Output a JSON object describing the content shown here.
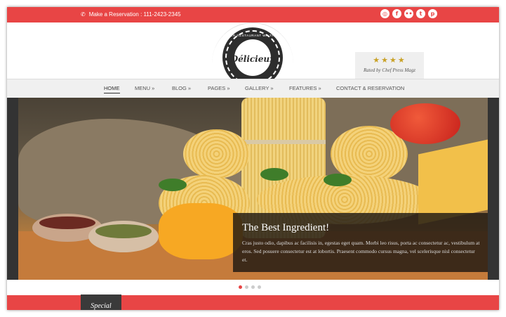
{
  "topbar": {
    "reservation": "Make a Reservation : 111-2423-2345",
    "social": [
      {
        "icon": "share-icon",
        "glyph": "◎"
      },
      {
        "icon": "facebook-icon",
        "glyph": "f"
      },
      {
        "icon": "flickr-icon",
        "glyph": "••"
      },
      {
        "icon": "twitter-icon",
        "glyph": "t"
      },
      {
        "icon": "pinterest-icon",
        "glyph": "p"
      }
    ]
  },
  "logo": {
    "name": "Délicieux",
    "arc_text": "SUPER RESTAURANT WP THEME",
    "since": "SINCE 1996"
  },
  "rating": {
    "stars": "★★★★",
    "caption": "Rated by Chef Press Magz"
  },
  "nav": {
    "items": [
      {
        "label": "HOME",
        "active": true
      },
      {
        "label": "MENU »"
      },
      {
        "label": "BLOG »"
      },
      {
        "label": "PAGES »"
      },
      {
        "label": "GALLERY »"
      },
      {
        "label": "FEATURES »"
      },
      {
        "label": "CONTACT & RESERVATION"
      }
    ]
  },
  "slider": {
    "title": "The Best Ingredient!",
    "text": "Cras justo odio, dapibus ac facilisis in, egestas eget quam. Morbi leo risus, porta ac consectetur ac, vestibulum at eros. Sed posuere consectetur est at lobortis. Praesent commodo cursus magna, vel scelerisque nisl consectetur et.",
    "active_dot": 1,
    "dot_count": 4
  },
  "footer": {
    "special_label": "Special"
  },
  "colors": {
    "accent": "#e84545",
    "dark": "#2d2d2d",
    "star": "#c9a227"
  }
}
